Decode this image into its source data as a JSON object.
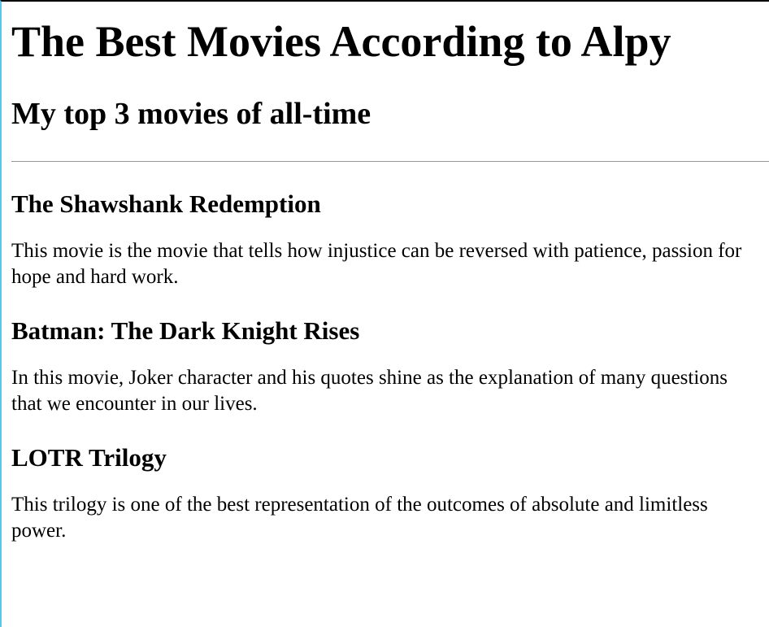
{
  "header": {
    "title": "The Best Movies According to Alpy",
    "subtitle": "My top 3 movies of all-time"
  },
  "movies": [
    {
      "title": "The Shawshank Redemption",
      "description": "This movie is the movie that tells how injustice can be reversed with patience, passion for hope and hard work."
    },
    {
      "title": "Batman: The Dark Knight Rises",
      "description": "In this movie, Joker character and his quotes shine as the explanation of many questions that we encounter in our lives."
    },
    {
      "title": "LOTR Trilogy",
      "description": "This trilogy is one of the best representation of the outcomes of absolute and limitless power."
    }
  ]
}
